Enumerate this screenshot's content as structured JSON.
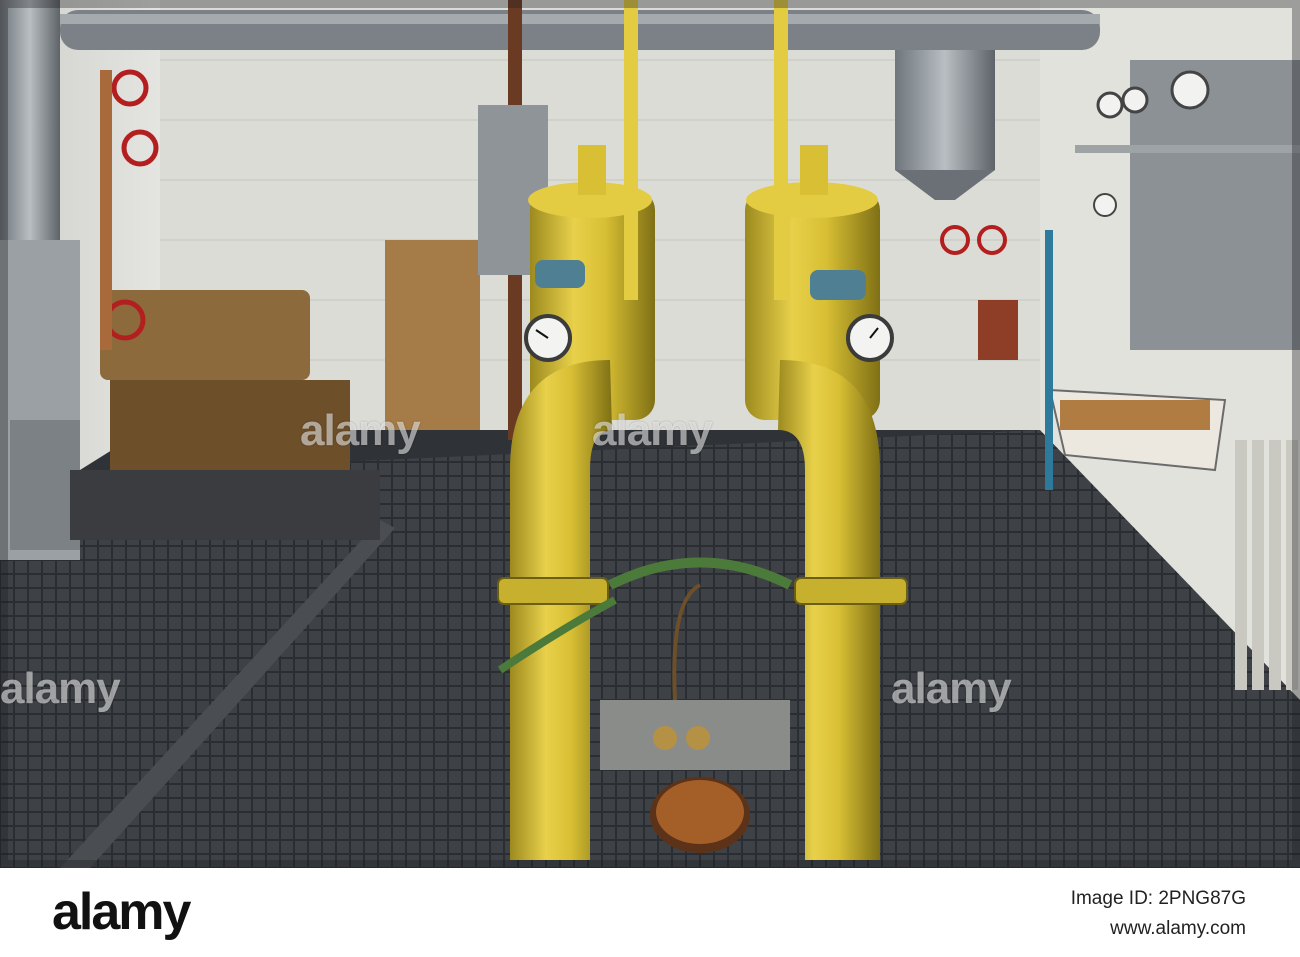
{
  "photo": {
    "subject": "industrial pump room with yellow pipes, valves and pressure gauges on metal grating floor"
  },
  "watermark": {
    "text": "alamy"
  },
  "footer": {
    "brand": "alamy",
    "image_id": "Image ID: 2PNG87G",
    "site": "www.alamy.com"
  }
}
